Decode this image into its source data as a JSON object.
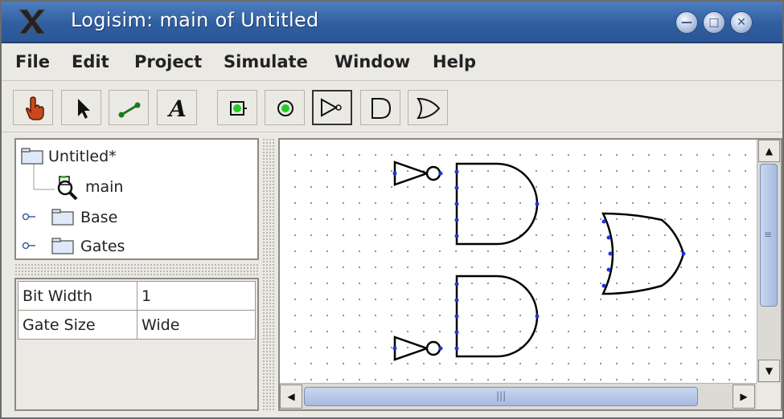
{
  "window": {
    "title": "Logisim: main of Untitled",
    "buttons": [
      "minimize",
      "maximize",
      "close"
    ]
  },
  "menu": [
    "File",
    "Edit",
    "Project",
    "Simulate",
    "Window",
    "Help"
  ],
  "toolbar": {
    "tools": [
      {
        "name": "poke-tool",
        "icon": "hand-pointer-icon"
      },
      {
        "name": "select-tool",
        "icon": "arrow-pointer-icon"
      },
      {
        "name": "wiring-tool",
        "icon": "wire-icon"
      },
      {
        "name": "text-tool",
        "icon": "text-A-icon",
        "label": "A"
      },
      {
        "name": "input-pin-tool",
        "icon": "input-pin-icon"
      },
      {
        "name": "output-pin-tool",
        "icon": "output-pin-icon"
      },
      {
        "name": "not-gate-tool",
        "icon": "not-gate-icon",
        "selected": true
      },
      {
        "name": "and-gate-tool",
        "icon": "and-gate-icon"
      },
      {
        "name": "or-gate-tool",
        "icon": "or-gate-icon"
      }
    ]
  },
  "explorer": {
    "project": "Untitled*",
    "items": [
      {
        "label": "main",
        "icon": "magnifier-circuit-icon"
      },
      {
        "label": "Base",
        "icon": "folder-icon"
      },
      {
        "label": "Gates",
        "icon": "folder-icon"
      }
    ]
  },
  "attributes": [
    {
      "name": "Bit Width",
      "value": "1"
    },
    {
      "name": "Gate Size",
      "value": "Wide"
    }
  ],
  "colors": {
    "titlebar": "#2f5fa0",
    "pin_dot": "#2233dd",
    "wire": "#000000"
  }
}
